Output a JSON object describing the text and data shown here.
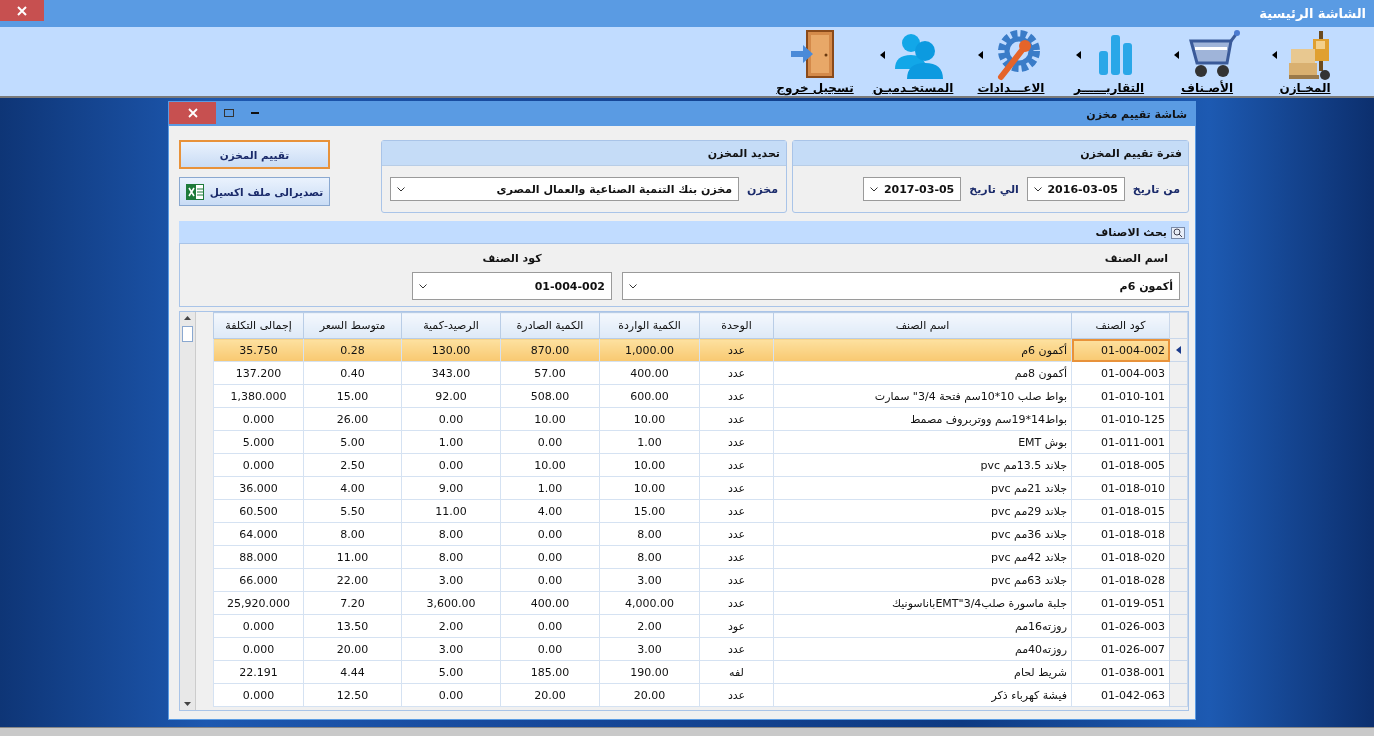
{
  "app_window": {
    "title": "الشاشة الرئيسية"
  },
  "toolbar": [
    {
      "label": "المخـازن",
      "submenu": true
    },
    {
      "label": "الأصـناف",
      "submenu": true
    },
    {
      "label": "التقاريــــــر",
      "submenu": true
    },
    {
      "label": "الاعـــدادات",
      "submenu": true
    },
    {
      "label": "المستخـدميـن",
      "submenu": true
    },
    {
      "label": "تسجيل خروج",
      "submenu": false
    }
  ],
  "dialog": {
    "title": "شاشة تقييم مخزن",
    "period_panel": {
      "title": "فترة تقييم المخزن",
      "from_label": "من تاريخ",
      "from_value": "2016-03-05",
      "to_label": "الي تاريخ",
      "to_value": "2017-03-05"
    },
    "store_panel": {
      "title": "تحديد المخزن",
      "store_label": "مخزن",
      "store_value": "مخزن بنك التنمية الصناعية والعمال المصرى"
    },
    "buttons": [
      {
        "label": "تقييم المخزن",
        "focused": true
      },
      {
        "label": "تصديرالى ملف اكسيل",
        "focused": false
      }
    ],
    "search": {
      "title": "بحث الاصناف",
      "name_label": "اسم الصنف",
      "name_value": "أكمون 6م",
      "code_label": "كود الصنف",
      "code_value": "01-004-002"
    },
    "table": {
      "columns": [
        "كود الصنف",
        "اسم الصنف",
        "الوحدة",
        "الكمية الواردة",
        "الكمية الصادرة",
        "الرصيد-كمية",
        "متوسط السعر",
        "إجمالى التكلفة"
      ],
      "rows": [
        {
          "selected": true,
          "cells": [
            "01-004-002",
            "أكمون 6م",
            "عدد",
            "1,000.00",
            "870.00",
            "130.00",
            "0.28",
            "35.750"
          ]
        },
        {
          "selected": false,
          "cells": [
            "01-004-003",
            "أكمون 8مم",
            "عدد",
            "400.00",
            "57.00",
            "343.00",
            "0.40",
            "137.200"
          ]
        },
        {
          "selected": false,
          "cells": [
            "01-010-101",
            "بواط صلب 10*10سم فتحة 3/4\" سمارت",
            "عدد",
            "600.00",
            "508.00",
            "92.00",
            "15.00",
            "1,380.000"
          ]
        },
        {
          "selected": false,
          "cells": [
            "01-010-125",
            "بواط14*19سم  ووتربروف مصمط",
            "عدد",
            "10.00",
            "10.00",
            "0.00",
            "26.00",
            "0.000"
          ]
        },
        {
          "selected": false,
          "cells": [
            "01-011-001",
            "بوش EMT",
            "عدد",
            "1.00",
            "0.00",
            "1.00",
            "5.00",
            "5.000"
          ]
        },
        {
          "selected": false,
          "cells": [
            "01-018-005",
            "جلاند 13.5مم pvc",
            "عدد",
            "10.00",
            "10.00",
            "0.00",
            "2.50",
            "0.000"
          ]
        },
        {
          "selected": false,
          "cells": [
            "01-018-010",
            "جلاند 21مم pvc",
            "عدد",
            "10.00",
            "1.00",
            "9.00",
            "4.00",
            "36.000"
          ]
        },
        {
          "selected": false,
          "cells": [
            "01-018-015",
            "جلاند 29مم pvc",
            "عدد",
            "15.00",
            "4.00",
            "11.00",
            "5.50",
            "60.500"
          ]
        },
        {
          "selected": false,
          "cells": [
            "01-018-018",
            "جلاند 36مم pvc",
            "عدد",
            "8.00",
            "0.00",
            "8.00",
            "8.00",
            "64.000"
          ]
        },
        {
          "selected": false,
          "cells": [
            "01-018-020",
            "جلاند 42مم pvc",
            "عدد",
            "8.00",
            "0.00",
            "8.00",
            "11.00",
            "88.000"
          ]
        },
        {
          "selected": false,
          "cells": [
            "01-018-028",
            "جلاند 63مم pvc",
            "عدد",
            "3.00",
            "0.00",
            "3.00",
            "22.00",
            "66.000"
          ]
        },
        {
          "selected": false,
          "cells": [
            "01-019-051",
            "جلبة  ماسورة صلب3/4\"EMTباناسونيك",
            "عدد",
            "4,000.00",
            "400.00",
            "3,600.00",
            "7.20",
            "25,920.000"
          ]
        },
        {
          "selected": false,
          "cells": [
            "01-026-003",
            "روزته16مم",
            "عود",
            "2.00",
            "0.00",
            "2.00",
            "13.50",
            "0.000"
          ]
        },
        {
          "selected": false,
          "cells": [
            "01-026-007",
            "روزته40مم",
            "عدد",
            "3.00",
            "0.00",
            "3.00",
            "20.00",
            "0.000"
          ]
        },
        {
          "selected": false,
          "cells": [
            "01-038-001",
            "شريط لحام",
            "لفه",
            "190.00",
            "185.00",
            "5.00",
            "4.44",
            "22.191"
          ]
        },
        {
          "selected": false,
          "cells": [
            "01-042-063",
            "فيشة كهرباء ذكر",
            "عدد",
            "20.00",
            "20.00",
            "0.00",
            "12.50",
            "0.000"
          ]
        }
      ]
    }
  }
}
